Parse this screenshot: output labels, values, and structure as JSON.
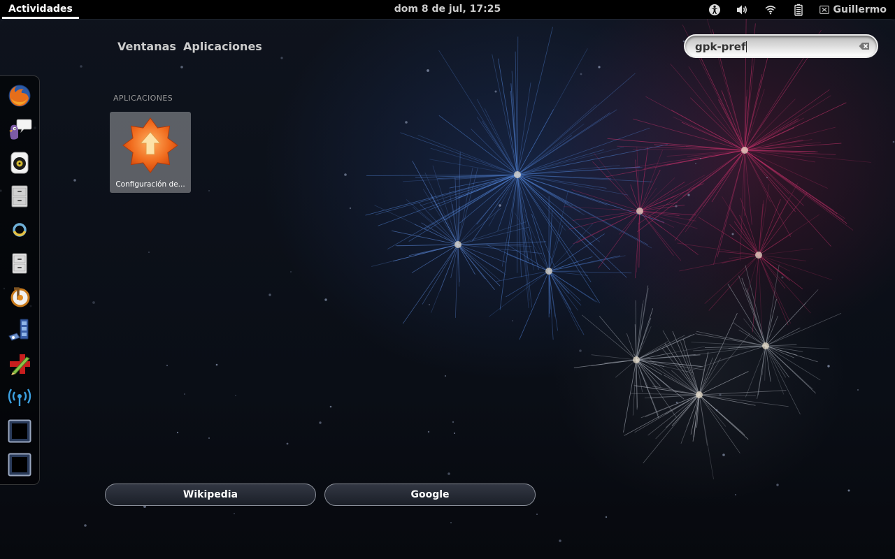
{
  "top_bar": {
    "activities_label": "Actividades",
    "clock": "dom  8 de jul, 17:25",
    "user_name": "Guillermo",
    "tray_icons": [
      "accessibility-icon",
      "volume-icon",
      "wifi-icon",
      "battery-icon",
      "user-status-icon"
    ]
  },
  "view_tabs": {
    "windows_label": "Ventanas",
    "applications_label": "Aplicaciones"
  },
  "search": {
    "value": "gpk-pref",
    "clear_icon": "clear-text-icon"
  },
  "dash": {
    "items": [
      {
        "icon": "firefox-icon"
      },
      {
        "icon": "pidgin-icon"
      },
      {
        "icon": "rhythmbox-icon"
      },
      {
        "icon": "file-manager-icon"
      },
      {
        "icon": "disk-ring-icon"
      },
      {
        "icon": "file-cabinet-icon"
      },
      {
        "icon": "bittorrent-icon"
      },
      {
        "icon": "video-editor-icon"
      },
      {
        "icon": "text-editor-icon"
      },
      {
        "icon": "wireless-hotspot-icon"
      },
      {
        "icon": "blank-window-icon"
      },
      {
        "icon": "blank-window-icon"
      }
    ]
  },
  "results": {
    "section_title": "APLICACIONES",
    "apps": [
      {
        "label": "Configuración de...",
        "icon": "software-update-icon"
      }
    ]
  },
  "search_providers": {
    "wikipedia_label": "Wikipedia",
    "google_label": "Google"
  },
  "colors": {
    "top_bar": "#000000",
    "background": "#0b0f17",
    "update_icon_orange": "#f06a1c"
  }
}
